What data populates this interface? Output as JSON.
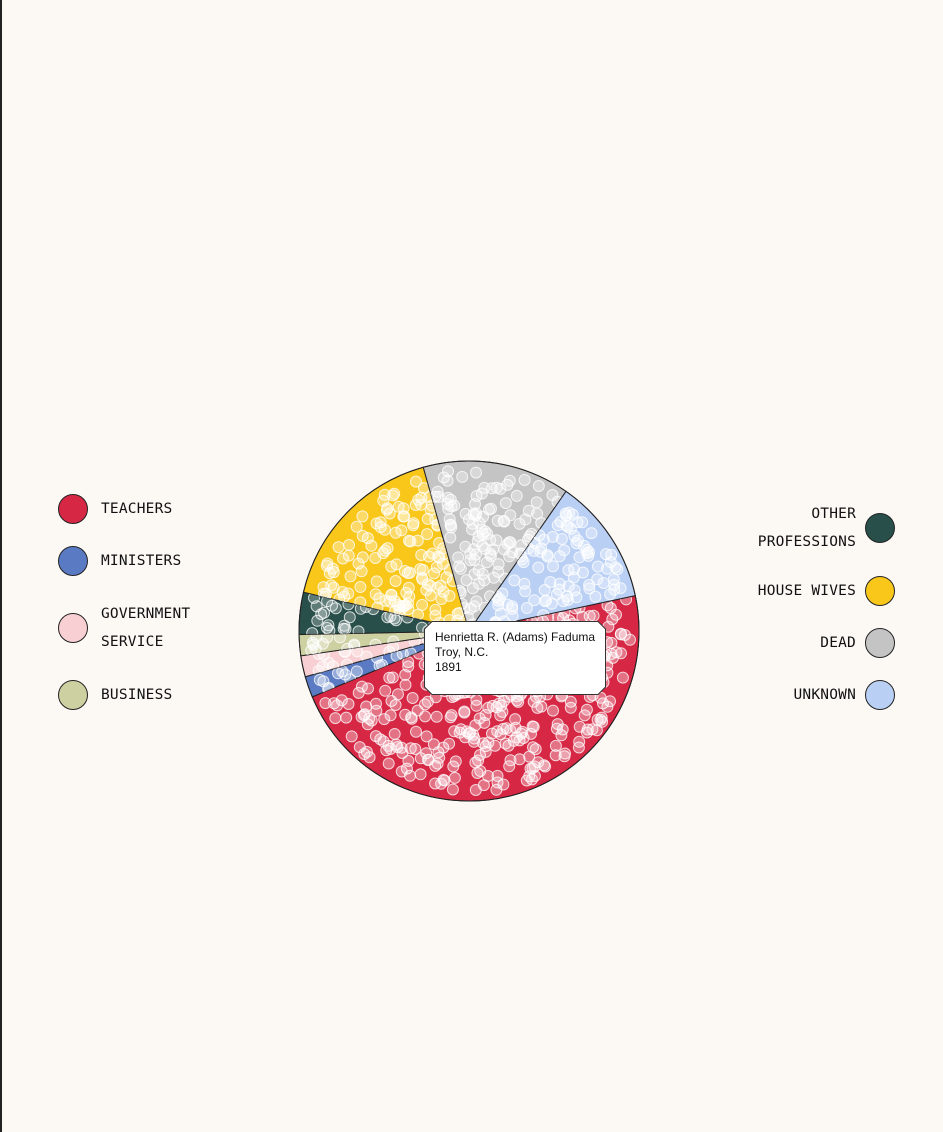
{
  "chart_data": {
    "type": "pie",
    "categories": [
      "Teachers",
      "Ministers",
      "Government Service",
      "Business",
      "Other Professions",
      "House Wives",
      "Dead",
      "Unknown"
    ],
    "values": [
      47,
      2,
      2,
      2,
      4,
      17,
      14,
      12
    ],
    "colors": {
      "Teachers": "#d62744",
      "Ministers": "#5a7bc4",
      "Government Service": "#f8cfd2",
      "Business": "#cdd0a0",
      "Other Professions": "#294f4b",
      "House Wives": "#f9c61a",
      "Dead": "#c4c4c4",
      "Unknown": "#b9cff4"
    },
    "start_angle_deg": 78
  },
  "legend": {
    "left": [
      {
        "label": "Teachers",
        "color": "#d62744"
      },
      {
        "label": "Ministers",
        "color": "#5a7bc4"
      },
      {
        "label": "Government\nService",
        "color": "#f8cfd2"
      },
      {
        "label": "Business",
        "color": "#cdd0a0"
      }
    ],
    "right": [
      {
        "label": "Other\nProfessions",
        "color": "#294f4b"
      },
      {
        "label": "House Wives",
        "color": "#f9c61a"
      },
      {
        "label": "Dead",
        "color": "#c4c4c4"
      },
      {
        "label": "Unknown",
        "color": "#b9cff4"
      }
    ]
  },
  "tooltip": {
    "name": "Henrietta R. (Adams) Faduma",
    "place": "Troy, N.C.",
    "year": "1891"
  }
}
